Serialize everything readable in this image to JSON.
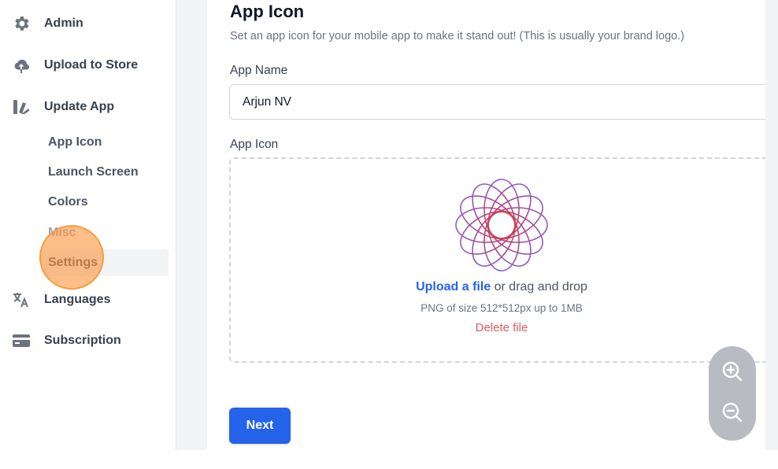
{
  "sidebar": {
    "items": [
      {
        "label": "Admin",
        "icon": "gear-icon"
      },
      {
        "label": "Upload to Store",
        "icon": "cloud-upload-icon"
      },
      {
        "label": "Update App",
        "icon": "paint-swatch-icon"
      },
      {
        "label": "Languages",
        "icon": "translate-icon"
      },
      {
        "label": "Subscription",
        "icon": "credit-card-icon"
      }
    ],
    "sub_items": [
      "App Icon",
      "Launch Screen",
      "Colors",
      "Misc",
      "Settings"
    ]
  },
  "main": {
    "title": "App Icon",
    "subtitle": "Set an app icon for your mobile app to make it stand out! (This is usually your brand logo.)",
    "app_name_label": "App Name",
    "app_name_value": "Arjun NV",
    "app_icon_label": "App Icon",
    "upload_link": "Upload a file",
    "upload_text": " or drag and drop",
    "upload_hint": "PNG of size 512*512px up to 1MB",
    "delete_label": "Delete file",
    "next_label": "Next"
  },
  "zoom": {
    "in_icon": "zoom-in-icon",
    "out_icon": "zoom-out-icon"
  },
  "colors": {
    "accent": "#2563eb",
    "danger": "#e05a5a",
    "highlight": "#fb923c"
  }
}
